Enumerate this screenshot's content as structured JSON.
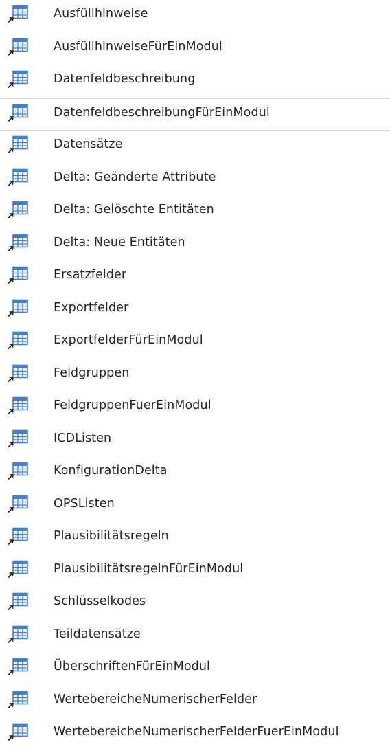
{
  "navigation_pane": {
    "selected_index": 3,
    "item_icon": "linked-table-icon",
    "colors": {
      "text": "#262626",
      "selection_border": "#f2c8c3",
      "icon_grid": "#4a7fbf",
      "icon_arrow": "#2b2b2b"
    },
    "items": [
      {
        "label": "Ausfüllhinweise"
      },
      {
        "label": "AusfüllhinweiseFürEinModul"
      },
      {
        "label": "Datenfeldbeschreibung"
      },
      {
        "label": "DatenfeldbeschreibungFürEinModul"
      },
      {
        "label": "Datensätze"
      },
      {
        "label": "Delta: Geänderte Attribute"
      },
      {
        "label": "Delta: Gelöschte Entitäten"
      },
      {
        "label": "Delta: Neue Entitäten"
      },
      {
        "label": "Ersatzfelder"
      },
      {
        "label": "Exportfelder"
      },
      {
        "label": "ExportfelderFürEinModul"
      },
      {
        "label": "Feldgruppen"
      },
      {
        "label": "FeldgruppenFuerEinModul"
      },
      {
        "label": "ICDListen"
      },
      {
        "label": "KonfigurationDelta"
      },
      {
        "label": "OPSListen"
      },
      {
        "label": "Plausibilitätsregeln"
      },
      {
        "label": "PlausibilitätsregelnFürEinModul"
      },
      {
        "label": "Schlüsselkodes"
      },
      {
        "label": "Teildatensätze"
      },
      {
        "label": "ÜberschriftenFürEinModul"
      },
      {
        "label": "WertebereicheNumerischerFelder"
      },
      {
        "label": "WertebereicheNumerischerFelderFuerEinModul"
      }
    ]
  }
}
